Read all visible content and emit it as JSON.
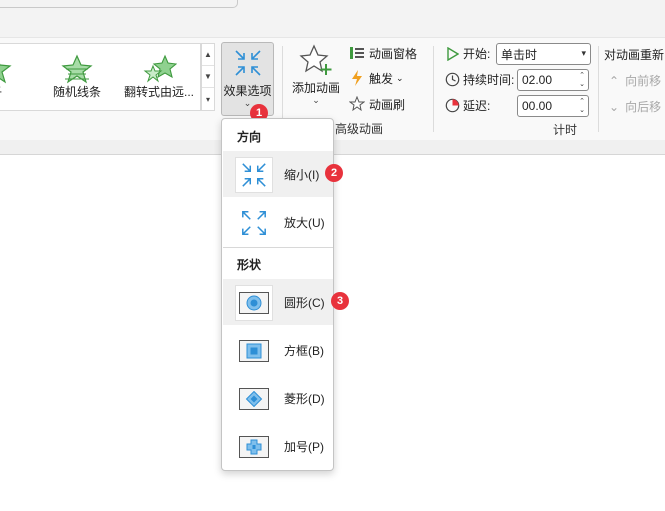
{
  "ribbon": {
    "gallery": {
      "items": [
        {
          "label": "子",
          "icon": "star-fragment-icon"
        },
        {
          "label": "随机线条",
          "icon": "star-random-lines-icon"
        },
        {
          "label": "翻转式由远...",
          "icon": "star-flip-icon"
        }
      ]
    },
    "effect_options": {
      "label": "效果选项",
      "icon": "shrink-arrows-icon"
    },
    "add_animation": {
      "label": "添加动画",
      "icon": "star-add-icon"
    },
    "animation_pane": {
      "label": "动画窗格"
    },
    "trigger": {
      "label": "触发"
    },
    "animation_painter": {
      "label": "动画刷"
    },
    "advanced_group_label": "高级动画",
    "timing": {
      "start_label": "开始:",
      "start_value": "单击时",
      "duration_label": "持续时间:",
      "duration_value": "02.00",
      "delay_label": "延迟:",
      "delay_value": "00.00",
      "group_label": "计时"
    },
    "reorder": {
      "title": "对动画重新",
      "move_earlier": "向前移",
      "move_later": "向后移"
    }
  },
  "menu": {
    "direction_header": "方向",
    "shape_header": "形状",
    "items": [
      {
        "label": "缩小(I)",
        "icon": "shrink-arrows-icon"
      },
      {
        "label": "放大(U)",
        "icon": "expand-arrows-icon"
      },
      {
        "label": "圆形(C)",
        "icon": "circle-shape-icon"
      },
      {
        "label": "方框(B)",
        "icon": "box-shape-icon"
      },
      {
        "label": "菱形(D)",
        "icon": "diamond-shape-icon"
      },
      {
        "label": "加号(P)",
        "icon": "plus-shape-icon"
      }
    ]
  },
  "badges": [
    "1",
    "2",
    "3"
  ],
  "colors": {
    "accent_blue": "#2e8fd6",
    "star_green": "#5cb85c",
    "badge_red": "#e8323c",
    "menu_highlight": "#f0f0f0"
  }
}
